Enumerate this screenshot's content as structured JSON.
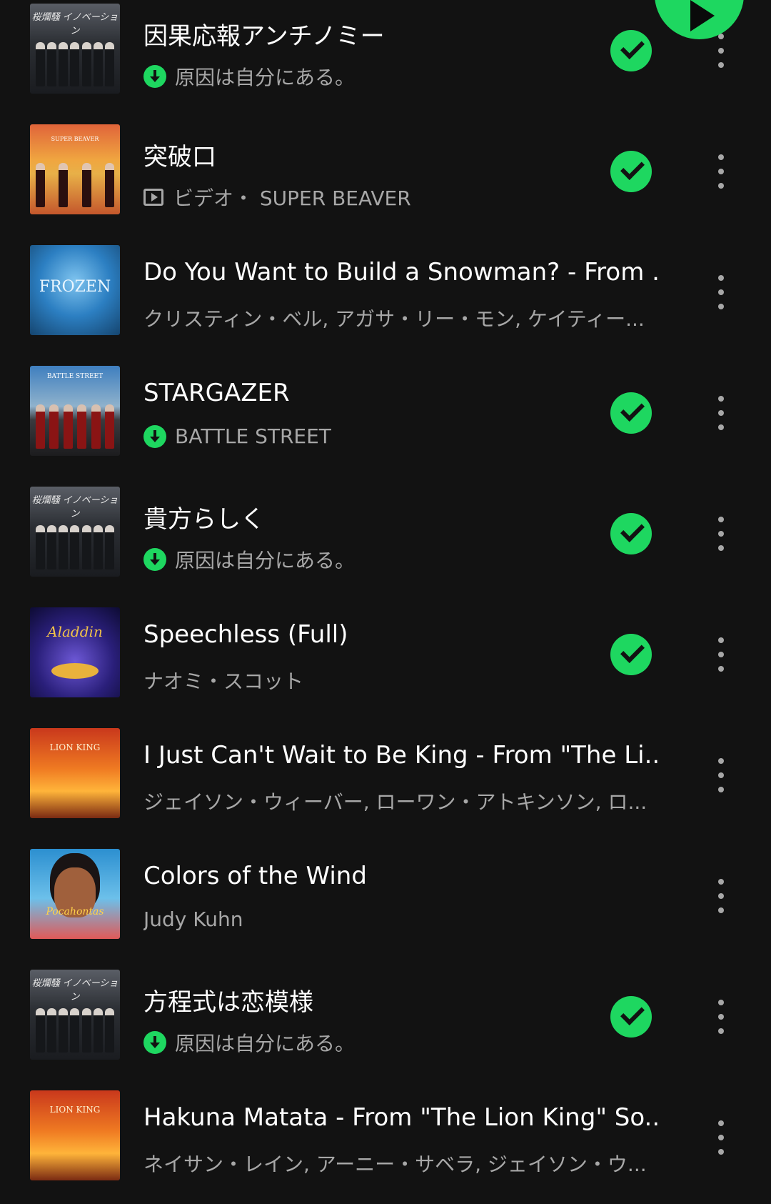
{
  "tracks": [
    {
      "title": "因果応報アンチノミー",
      "subtitle": "原因は自分にある。",
      "downloaded": true,
      "is_video": false,
      "liked": true,
      "art": "art-grey",
      "art_label": "桜爛騒 イノベーション"
    },
    {
      "title": "突破口",
      "subtitle": "ビデオ・ SUPER BEAVER",
      "downloaded": false,
      "is_video": true,
      "liked": true,
      "art": "art-beaver",
      "art_label": "SUPER BEAVER"
    },
    {
      "title": "Do You Want to Build a Snowman? - From ...",
      "subtitle": "クリスティン・ベル, アガサ・リー・モン, ケイティー...",
      "downloaded": false,
      "is_video": false,
      "liked": false,
      "art": "art-frozen",
      "art_label": "FROZEN"
    },
    {
      "title": "STARGAZER",
      "subtitle": "BATTLE STREET",
      "downloaded": true,
      "is_video": false,
      "liked": true,
      "art": "art-street",
      "art_label": "BATTLE STREET"
    },
    {
      "title": "貴方らしく",
      "subtitle": "原因は自分にある。",
      "downloaded": true,
      "is_video": false,
      "liked": true,
      "art": "art-grey",
      "art_label": "桜爛騒 イノベーション"
    },
    {
      "title": "Speechless (Full)",
      "subtitle": "ナオミ・スコット",
      "downloaded": false,
      "is_video": false,
      "liked": true,
      "art": "art-aladdin",
      "art_label": "Aladdin"
    },
    {
      "title": "I Just Can't Wait to Be King - From \"The Li...",
      "subtitle": "ジェイソン・ウィーバー, ローワン・アトキンソン, ロ...",
      "downloaded": false,
      "is_video": false,
      "liked": false,
      "art": "art-lion",
      "art_label": "LION KING"
    },
    {
      "title": "Colors of the Wind",
      "subtitle": "Judy Kuhn",
      "downloaded": false,
      "is_video": false,
      "liked": false,
      "art": "art-poca",
      "art_label": "Pocahontas"
    },
    {
      "title": "方程式は恋模様",
      "subtitle": "原因は自分にある。",
      "downloaded": true,
      "is_video": false,
      "liked": true,
      "art": "art-grey",
      "art_label": "桜爛騒 イノベーション"
    },
    {
      "title": "Hakuna Matata - From \"The Lion King\" So...",
      "subtitle": "ネイサン・レイン, アーニー・サベラ, ジェイソン・ウ...",
      "downloaded": false,
      "is_video": false,
      "liked": false,
      "art": "art-lion",
      "art_label": "LION KING"
    }
  ],
  "icons": {
    "play": "play-icon",
    "download": "download-icon",
    "video": "video-icon",
    "liked": "check-circle-icon",
    "more": "more-vert-icon"
  },
  "colors": {
    "background": "#121212",
    "accent": "#1ed760",
    "title": "#ffffff",
    "subtitle": "#a7a7a7"
  }
}
